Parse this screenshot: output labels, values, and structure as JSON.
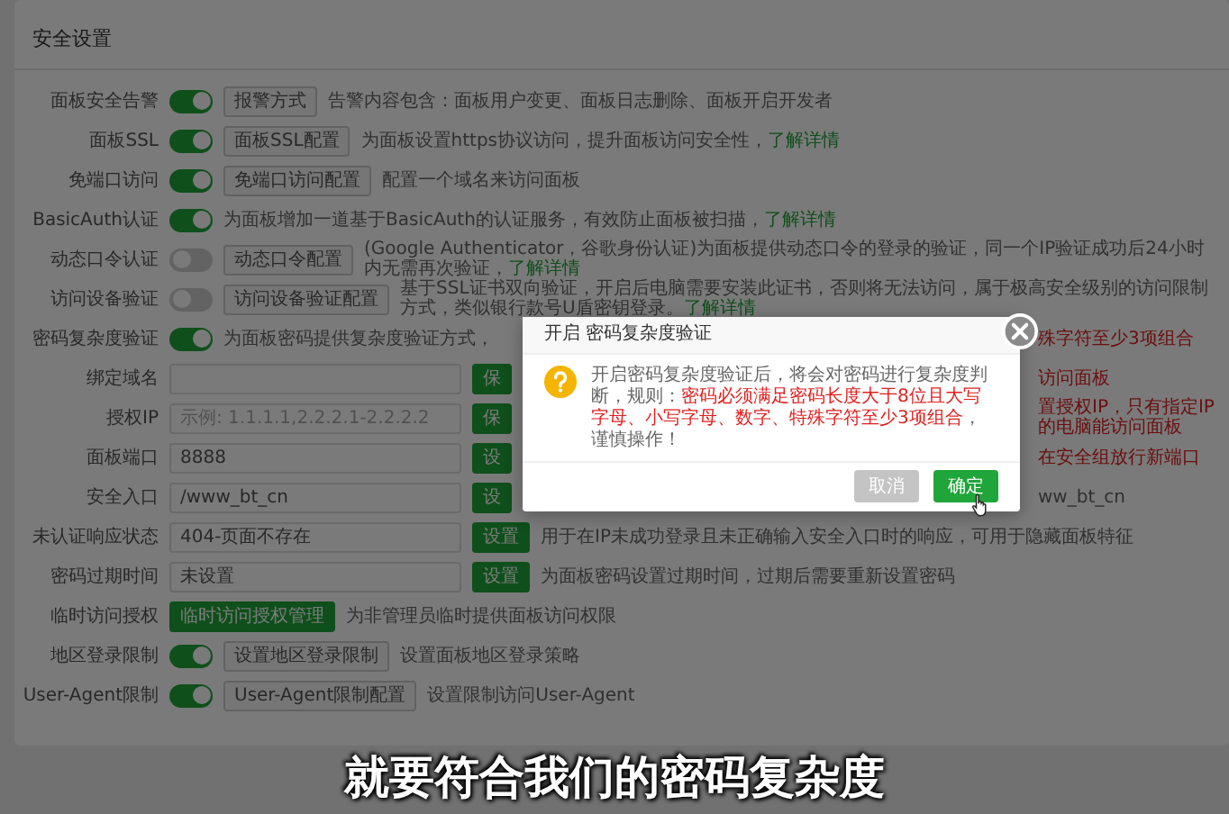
{
  "panel": {
    "title": "安全设置"
  },
  "rows": [
    {
      "kind": "toggle",
      "label": "面板安全告警",
      "on": true,
      "button": "报警方式",
      "desc": "告警内容包含：面板用户变更、面板日志删除、面板开启开发者"
    },
    {
      "kind": "toggle",
      "label": "面板SSL",
      "on": true,
      "button": "面板SSL配置",
      "desc": "为面板设置https协议访问，提升面板访问安全性，",
      "link": "了解详情"
    },
    {
      "kind": "toggle",
      "label": "免端口访问",
      "on": true,
      "button": "免端口访问配置",
      "desc": "配置一个域名来访问面板"
    },
    {
      "kind": "toggle",
      "label": "BasicAuth认证",
      "on": true,
      "desc": "为面板增加一道基于BasicAuth的认证服务，有效防止面板被扫描，",
      "link": "了解详情"
    },
    {
      "kind": "toggle",
      "label": "动态口令认证",
      "on": false,
      "button": "动态口令配置",
      "desc": "(Google Authenticator，谷歌身份认证)为面板提供动态口令的登录的验证，同一个IP验证成功后24小时内无需再次验证，",
      "link": "了解详情"
    },
    {
      "kind": "toggle",
      "label": "访问设备验证",
      "on": false,
      "button": "访问设备验证配置",
      "desc": "基于SSL证书双向验证，开启后电脑需要安装此证书，否则将无法访问，属于极高安全级别的访问限制方式，类似银行款号U盾密钥登录。",
      "link": "了解详情"
    },
    {
      "kind": "toggle",
      "label": "密码复杂度验证",
      "on": true,
      "desc": "为面板密码提供复杂度验证方式，",
      "tail": {
        "text": "殊字符至少3项组合",
        "kind": "warning"
      }
    },
    {
      "kind": "input",
      "label": "绑定域名",
      "button": "保",
      "tail": {
        "text": "访问面板",
        "kind": "warning"
      }
    },
    {
      "kind": "input",
      "label": "授权IP",
      "placeholder": "示例: 1.1.1.1,2.2.2.1-2.2.2.2",
      "button": "保",
      "tail": {
        "text": "置授权IP，只有指定IP的电脑能访问面板",
        "kind": "warning"
      }
    },
    {
      "kind": "input",
      "label": "面板端口",
      "value": "8888",
      "button": "设",
      "tail": {
        "text": "在安全组放行新端口",
        "kind": "warning"
      }
    },
    {
      "kind": "input",
      "label": "安全入口",
      "value": "/www_bt_cn",
      "button": "设",
      "tail": {
        "text": "ww_bt_cn",
        "kind": "plain"
      }
    },
    {
      "kind": "input",
      "label": "未认证响应状态",
      "value": "404-页面不存在",
      "button": "设置",
      "desc": "用于在IP未成功登录且未正确输入安全入口时的响应，可用于隐藏面板特征"
    },
    {
      "kind": "input",
      "label": "密码过期时间",
      "value": "未设置",
      "button": "设置",
      "desc": "为面板密码设置过期时间，过期后需要重新设置密码"
    },
    {
      "kind": "action",
      "label": "临时访问授权",
      "button": "临时访问授权管理",
      "desc": "为非管理员临时提供面板访问权限"
    },
    {
      "kind": "toggle",
      "label": "地区登录限制",
      "on": true,
      "button": "设置地区登录限制",
      "desc": "设置面板地区登录策略"
    },
    {
      "kind": "toggle",
      "label": "User-Agent限制",
      "on": true,
      "button": "User-Agent限制配置",
      "desc": "设置限制访问User-Agent"
    }
  ],
  "dialog": {
    "title": "开启 密码复杂度验证",
    "segments": [
      {
        "text": "开启密码复杂度验证后，将会对密码进行复杂度判断，规则：",
        "kind": "plain"
      },
      {
        "text": "密码必须满足密码长度大于8位且大写字母、小写字母、数字、特殊字符至少3项组合",
        "kind": "warning"
      },
      {
        "text": "，谨慎操作！",
        "kind": "plain"
      }
    ],
    "buttons": [
      {
        "label": "取消",
        "kind": "cancel"
      },
      {
        "label": "确定",
        "kind": "confirm"
      }
    ]
  },
  "subtitle": "就要符合我们的密码复杂度"
}
